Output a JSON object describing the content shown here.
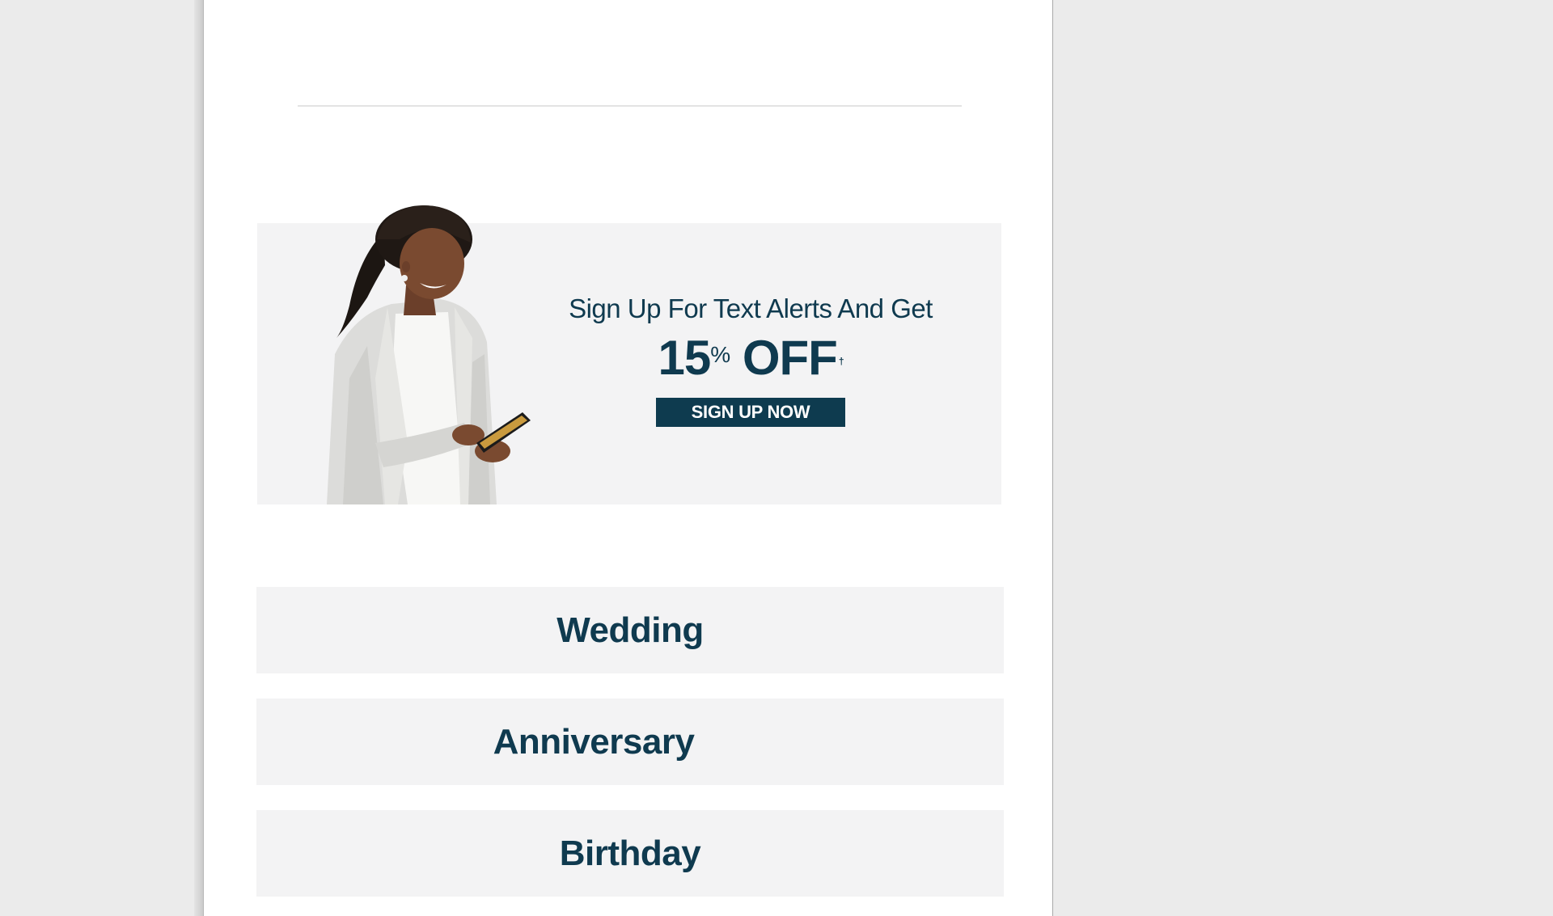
{
  "colors": {
    "brand_navy": "#0e3b4f",
    "tile_background": "#f3f3f4",
    "page_background": "#ebebeb"
  },
  "promo": {
    "headline": "Sign Up For Text Alerts And Get",
    "offer_number": "15",
    "offer_percent": "%",
    "offer_word": "OFF",
    "offer_mark": "†",
    "button_label": "SIGN UP NOW",
    "image_icon": "woman-with-phone-photo"
  },
  "categories": [
    {
      "label": "Wedding"
    },
    {
      "label": "Anniversary"
    },
    {
      "label": "Birthday"
    }
  ]
}
